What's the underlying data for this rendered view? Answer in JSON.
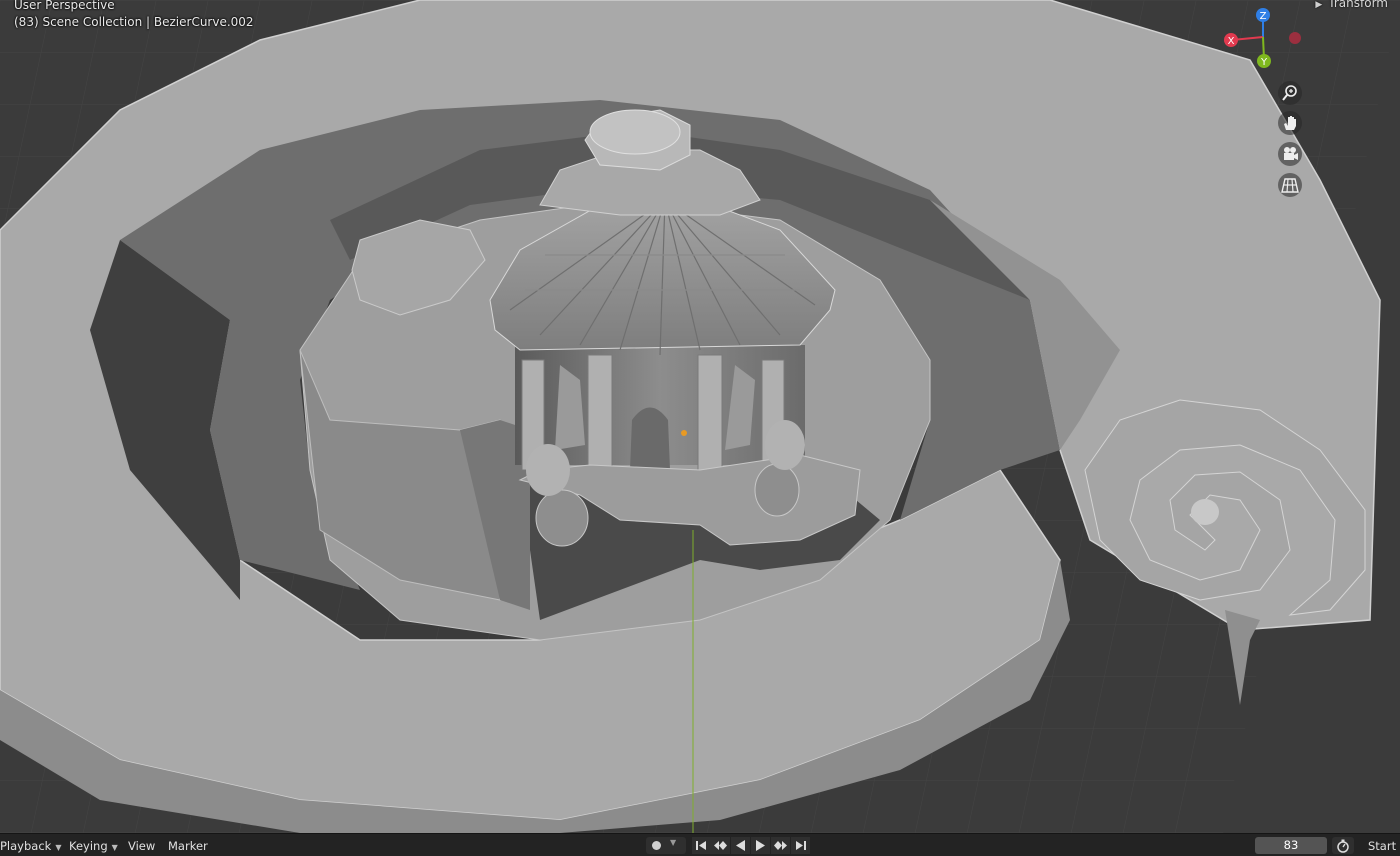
{
  "viewport": {
    "view_mode": "User Perspective",
    "scene_info": "(83) Scene Collection | BezierCurve.002",
    "sidebar_tab": "Transform"
  },
  "gizmo": {
    "axis_z": "Z",
    "axis_x": "X",
    "axis_y": "Y",
    "colors": {
      "z": "#2f7fe6",
      "x": "#e23a4f",
      "y": "#7fb81e",
      "neg_x": "#9b2f3f"
    }
  },
  "nav_buttons": [
    "zoom-icon",
    "hand-pan-icon",
    "camera-icon",
    "grid-ortho-icon"
  ],
  "timeline": {
    "menus": [
      "Playback",
      "Keying",
      "View",
      "Marker"
    ],
    "controls": [
      "jump-start-icon",
      "prev-keyframe-icon",
      "play-reverse-icon",
      "play-icon",
      "next-keyframe-icon",
      "jump-end-icon"
    ],
    "current_frame": "83",
    "start_label": "Start"
  }
}
